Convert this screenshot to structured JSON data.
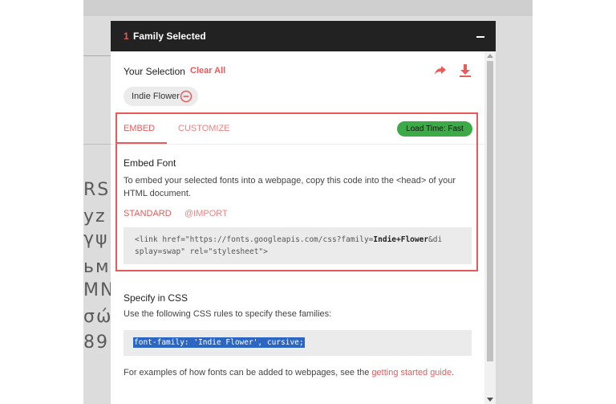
{
  "background": {
    "glyph_rows": [
      "RS",
      "yz",
      "γψ",
      "ьм",
      "MN",
      "σώ",
      "89"
    ]
  },
  "panel": {
    "header": {
      "count": "1",
      "title": "Family Selected"
    },
    "selection": {
      "label": "Your Selection",
      "clear_all": "Clear All",
      "share_icon": "share-arrow-icon",
      "download_icon": "download-icon",
      "chips": [
        {
          "label": "Indie Flower",
          "remove_icon": "remove-circle-icon"
        }
      ]
    },
    "tabs": [
      {
        "label": "EMBED",
        "active": true
      },
      {
        "label": "CUSTOMIZE",
        "active": false
      }
    ],
    "load_time": "Load Time: Fast",
    "embed": {
      "title": "Embed Font",
      "description": "To embed your selected fonts into a webpage, copy this code into the <head> of your HTML document.",
      "options": [
        {
          "label": "STANDARD",
          "active": true
        },
        {
          "label": "@IMPORT",
          "active": false
        }
      ],
      "code_prefix": "<link href=\"https://fonts.googleapis.com/css?family=",
      "code_family": "Indie+Flower",
      "code_suffix": "&display=swap\" rel=\"stylesheet\">"
    },
    "css": {
      "title": "Specify in CSS",
      "description": "Use the following CSS rules to specify these families:",
      "rule": "font-family: 'Indie Flower', cursive;"
    },
    "footer": {
      "text": "For examples of how fonts can be added to webpages, see the ",
      "link": "getting started guide",
      "end": "."
    }
  },
  "colors": {
    "accent": "#e95a5a",
    "header_bg": "#222222",
    "badge_green": "#3daa48",
    "highlight_blue": "#2b66c3"
  }
}
